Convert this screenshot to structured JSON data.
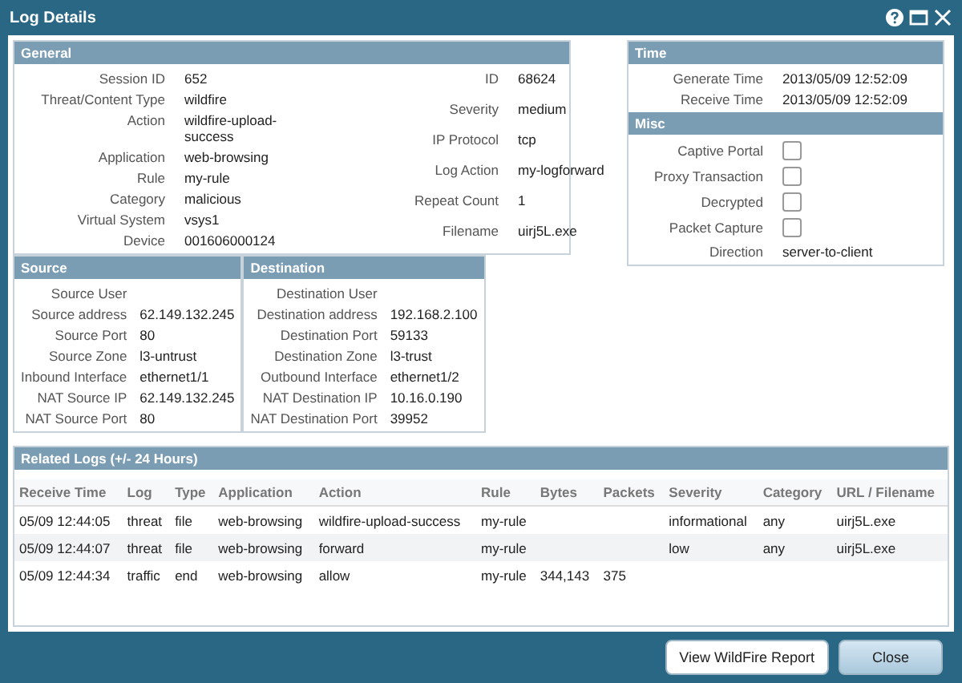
{
  "window": {
    "title": "Log Details"
  },
  "general": {
    "title": "General",
    "left": [
      {
        "label": "Session ID",
        "value": "652"
      },
      {
        "label": "Threat/Content Type",
        "value": "wildfire"
      },
      {
        "label": "Action",
        "value": "wildfire-upload-success"
      },
      {
        "label": "Application",
        "value": "web-browsing"
      },
      {
        "label": "Rule",
        "value": "my-rule"
      },
      {
        "label": "Category",
        "value": "malicious"
      },
      {
        "label": "Virtual System",
        "value": "vsys1"
      },
      {
        "label": "Device",
        "value": "001606000124"
      }
    ],
    "right": [
      {
        "label": "ID",
        "value": "68624"
      },
      {
        "label": "Severity",
        "value": "medium"
      },
      {
        "label": "IP Protocol",
        "value": "tcp"
      },
      {
        "label": "Log Action",
        "value": "my-logforward"
      },
      {
        "label": "Repeat Count",
        "value": "1"
      },
      {
        "label": "Filename",
        "value": "uirj5L.exe"
      }
    ]
  },
  "time": {
    "title": "Time",
    "rows": [
      {
        "label": "Generate Time",
        "value": "2013/05/09 12:52:09"
      },
      {
        "label": "Receive Time",
        "value": "2013/05/09 12:52:09"
      }
    ]
  },
  "misc": {
    "title": "Misc",
    "rows": [
      {
        "kind": "checkbox",
        "label": "Captive Portal",
        "checked": false
      },
      {
        "kind": "checkbox",
        "label": "Proxy Transaction",
        "checked": false
      },
      {
        "kind": "checkbox",
        "label": "Decrypted",
        "checked": false
      },
      {
        "kind": "checkbox",
        "label": "Packet Capture",
        "checked": false
      },
      {
        "kind": "text",
        "label": "Direction",
        "value": "server-to-client"
      }
    ]
  },
  "source": {
    "title": "Source",
    "rows": [
      {
        "label": "Source User"
      },
      {
        "label": "Source address",
        "value": "62.149.132.245"
      },
      {
        "label": "Source Port",
        "value": "80"
      },
      {
        "label": "Source Zone",
        "value": "l3-untrust"
      },
      {
        "label": "Inbound Interface",
        "value": "ethernet1/1"
      },
      {
        "label": "NAT Source IP",
        "value": "62.149.132.245"
      },
      {
        "label": "NAT Source Port",
        "value": "80"
      }
    ]
  },
  "destination": {
    "title": "Destination",
    "rows": [
      {
        "label": "Destination User"
      },
      {
        "label": "Destination address",
        "value": "192.168.2.100"
      },
      {
        "label": "Destination Port",
        "value": "59133"
      },
      {
        "label": "Destination Zone",
        "value": "l3-trust"
      },
      {
        "label": "Outbound Interface",
        "value": "ethernet1/2"
      },
      {
        "label": "NAT Destination IP",
        "value": "10.16.0.190"
      },
      {
        "label": "NAT Destination Port",
        "value": "39952"
      }
    ]
  },
  "related_logs": {
    "title": "Related Logs (+/- 24 Hours)",
    "columns": [
      "Receive Time",
      "Log",
      "Type",
      "Application",
      "Action",
      "Rule",
      "Bytes",
      "Packets",
      "Severity",
      "Category",
      "URL / Filename"
    ],
    "rows": [
      [
        "05/09 12:44:05",
        "threat",
        "file",
        "web-browsing",
        "wildfire-upload-success",
        "my-rule",
        "",
        "",
        "informational",
        "any",
        "uirj5L.exe"
      ],
      [
        "05/09 12:44:07",
        "threat",
        "file",
        "web-browsing",
        "forward",
        "my-rule",
        "",
        "",
        "low",
        "any",
        "uirj5L.exe"
      ],
      [
        "05/09 12:44:34",
        "traffic",
        "end",
        "web-browsing",
        "allow",
        "my-rule",
        "344,143",
        "375",
        "",
        "",
        ""
      ]
    ]
  },
  "buttons": [
    {
      "label": "View WildFire Report",
      "kind": "secondary"
    },
    {
      "label": "Close",
      "kind": "primary"
    }
  ]
}
